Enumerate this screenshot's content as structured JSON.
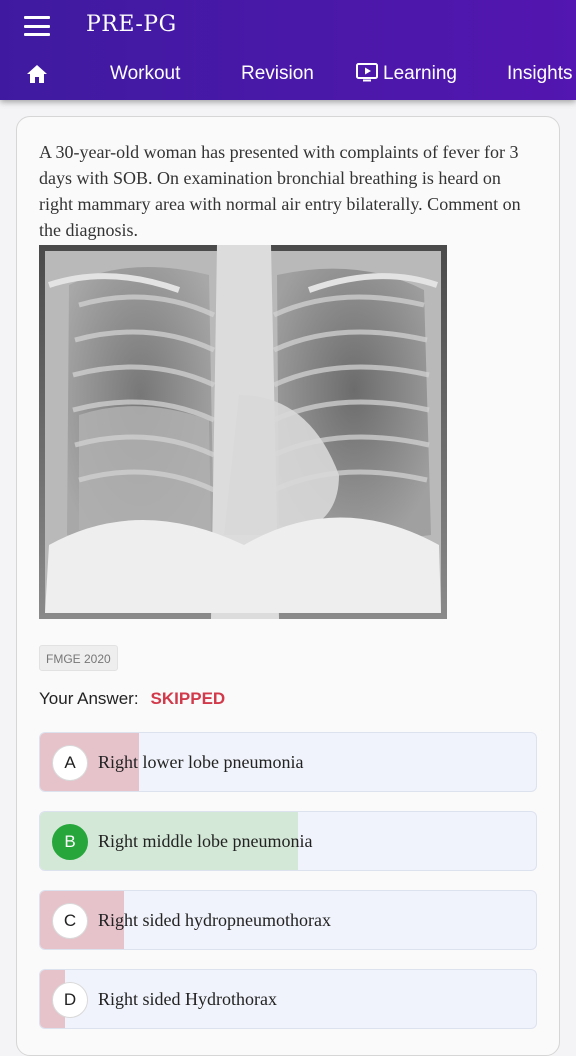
{
  "app": {
    "title": "PRE-PG"
  },
  "nav": {
    "items": [
      {
        "label": "Workout"
      },
      {
        "label": "Revision"
      },
      {
        "label": "Learning"
      },
      {
        "label": "Insights"
      }
    ]
  },
  "question": {
    "text": "A 30-year-old woman has presented with complaints of fever for 3 days with SOB. On examination bronchial breathing is heard on right mammary area with normal air entry bilaterally. Comment on the diagnosis.",
    "source_tag": "FMGE 2020",
    "answer_label": "Your Answer:",
    "answer_value": "SKIPPED"
  },
  "options": [
    {
      "letter": "A",
      "text": "Right lower lobe pneumonia",
      "percent": 20,
      "state": "wrong"
    },
    {
      "letter": "B",
      "text": "Right middle lobe pneumonia",
      "percent": 52,
      "state": "correct"
    },
    {
      "letter": "C",
      "text": "Right sided hydropneumothorax",
      "percent": 17,
      "state": "wrong"
    },
    {
      "letter": "D",
      "text": "Right sided Hydrothorax",
      "percent": 5,
      "state": "wrong"
    }
  ],
  "colors": {
    "accent": "#4a17a8",
    "wrong_fill": "#e6c3cb",
    "correct_fill": "#d4e8d7",
    "correct_badge": "#27a63c",
    "skipped": "#d23a4b"
  }
}
